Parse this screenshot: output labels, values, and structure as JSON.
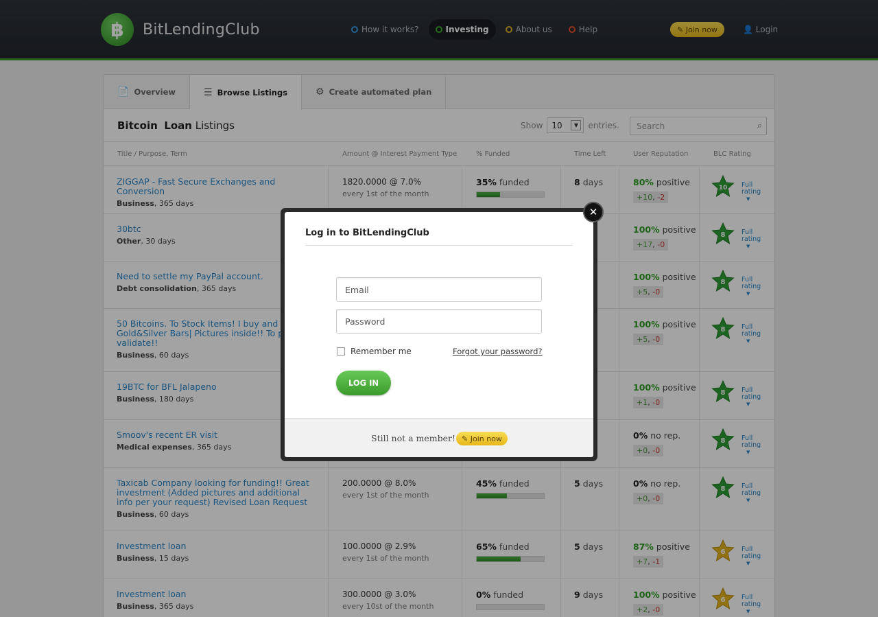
{
  "header": {
    "logo_symbol": "฿",
    "logo_text": "BitLendingClub",
    "nav": [
      {
        "label": "How it works?",
        "color": "#3b9be0"
      },
      {
        "label": "Investing",
        "color": "#3fae35"
      },
      {
        "label": "About us",
        "color": "#e0b31f"
      },
      {
        "label": "Help",
        "color": "#e0532f"
      }
    ],
    "join_label": "✎ Join now",
    "login_label": "Login"
  },
  "tabs": [
    {
      "icon": "📄",
      "label": "Overview"
    },
    {
      "icon": "☰",
      "label": "Browse Listings"
    },
    {
      "icon": "⚙",
      "label": "Create automated plan"
    }
  ],
  "listings_title": {
    "bold1": "Bitcoin",
    "bold2": "Loan",
    "rest": "Listings"
  },
  "show": {
    "label": "Show",
    "value": "10",
    "suffix": "entries."
  },
  "search_placeholder": "Search",
  "columns": [
    "Title / Purpose, Term",
    "Amount @ Interest Payment Type",
    "% Funded",
    "Time Left",
    "User Reputation",
    "BLC Rating"
  ],
  "full_rating": [
    "Full",
    "rating"
  ],
  "rows": [
    {
      "title": "ZIGGAP - Fast Secure Exchanges and Conversion",
      "cat": "Business",
      "term": ", 365 days",
      "amount": "1820.0000 @ 7.0%",
      "payment": "every 1st of the month",
      "funded": "35%",
      "funded_frac": 0.35,
      "time": "8",
      "rep": "80%",
      "rep_word": "positive",
      "plus": "+10",
      "minus": "-2",
      "rating": "10"
    },
    {
      "title": "30btc",
      "cat": "Other",
      "term": ", 30 days",
      "amount": "",
      "payment": "",
      "funded": "",
      "funded_frac": 0,
      "time": "",
      "rep": "100%",
      "rep_word": "positive",
      "plus": "+17",
      "minus": "-0",
      "rating": "8"
    },
    {
      "title": "Need to settle my PayPal account.",
      "cat": "Debt consolidation",
      "term": ", 365 days",
      "amount": "",
      "payment": "",
      "funded": "",
      "funded_frac": 0,
      "time": "",
      "rep": "100%",
      "rep_word": "positive",
      "plus": "+5",
      "minus": "-0",
      "rating": "8"
    },
    {
      "title": "50 Bitcoins. To Stock Items! I buy and sell Gold&Silver Bars| Pictures inside!! To proof validate!!",
      "cat": "Business",
      "term": ", 60 days",
      "amount": "",
      "payment": "",
      "funded": "",
      "funded_frac": 0,
      "time": "",
      "rep": "100%",
      "rep_word": "positive",
      "plus": "+5",
      "minus": "-0",
      "rating": "8"
    },
    {
      "title": "19BTC for BFL Jalapeno",
      "cat": "Business",
      "term": ", 180 days",
      "amount": "",
      "payment": "",
      "funded": "",
      "funded_frac": 0,
      "time": "",
      "rep": "100%",
      "rep_word": "positive",
      "plus": "+1",
      "minus": "-0",
      "rating": "8"
    },
    {
      "title": "Smoov's recent ER visit",
      "cat": "Medical expenses",
      "term": ", 365 days",
      "amount": "",
      "payment": "",
      "funded": "",
      "funded_frac": 0,
      "time": "",
      "rep": "0%",
      "rep_word": "no rep.",
      "plus": "+0",
      "minus": "-0",
      "rating": "8"
    },
    {
      "title": "Taxicab Company looking for funding!! Great investment (Added pictures and additional info per your request) Revised Loan Request",
      "cat": "Business",
      "term": ", 60 days",
      "amount": "200.0000 @ 8.0%",
      "payment": "every 1st of the month",
      "funded": "45%",
      "funded_frac": 0.45,
      "time": "5",
      "rep": "0%",
      "rep_word": "no rep.",
      "plus": "+0",
      "minus": "-0",
      "rating": "8"
    },
    {
      "title": "Investment loan",
      "cat": "Business",
      "term": ", 15 days",
      "amount": "100.0000 @ 2.9%",
      "payment": "every 1st of the month",
      "funded": "65%",
      "funded_frac": 0.65,
      "time": "5",
      "rep": "87%",
      "rep_word": "positive",
      "plus": "+7",
      "minus": "-1",
      "rating": "6"
    },
    {
      "title": "Investment loan",
      "cat": "Business",
      "term": ", 365 days",
      "amount": "300.0000 @ 3.0%",
      "payment": "every 10st of the month",
      "funded": "0%",
      "funded_frac": 0.0,
      "time": "9",
      "rep": "100%",
      "rep_word": "positive",
      "plus": "+2",
      "minus": "-0",
      "rating": "6"
    }
  ],
  "funded_word": "funded",
  "days_word": "days",
  "modal": {
    "title": "Log in to BitLendingClub",
    "email_placeholder": "Email",
    "password_placeholder": "Password",
    "remember_label": "Remember me",
    "forgot_label": "Forgot your password?",
    "login_label": "LOG IN",
    "footer_text": "Still not a member!",
    "footer_join": "✎ Join now",
    "close": "✕"
  }
}
